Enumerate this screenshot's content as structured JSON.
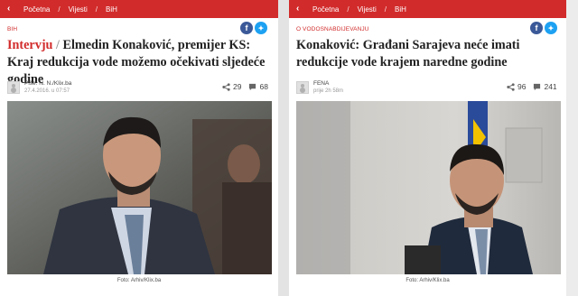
{
  "left": {
    "breadcrumb": [
      "Početna",
      "Vijesti",
      "BiH"
    ],
    "category": "BIH",
    "headline_kicker": "Intervju",
    "headline_sep": " / ",
    "headline_text": "Elmedin Konaković, premijer KS: Kraj redukcija vode možemo očekivati sljedeće godine",
    "author": "Piše: N. N./Klix.ba",
    "date": "27.4.2016. u 07:57",
    "shares": "29",
    "comments": "68",
    "photo_caption": "Foto: Arhiv/Klix.ba"
  },
  "right": {
    "breadcrumb": [
      "Početna",
      "Vijesti",
      "BiH"
    ],
    "category": "O VODOSNABDIJEVANJU",
    "headline_text": "Konaković: Građani Sarajeva neće imati redukcije vode krajem naredne godine",
    "author": "FENA",
    "date": "prije 2h 58m",
    "shares": "96",
    "comments": "241",
    "photo_caption": "Foto: Arhiv/Klix.ba"
  },
  "icons": {
    "back": "chevron-left-icon",
    "facebook": "facebook-icon",
    "twitter": "twitter-icon",
    "share": "share-icon",
    "comment": "comment-icon",
    "avatar": "avatar-icon"
  },
  "colors": {
    "brand_red": "#d22b2b",
    "facebook": "#3b5998",
    "twitter": "#1da1f2"
  }
}
